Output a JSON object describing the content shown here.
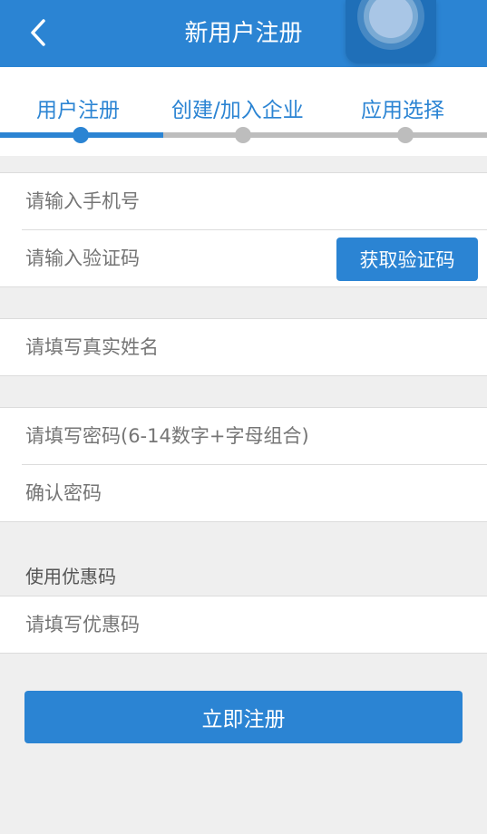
{
  "header": {
    "title": "新用户注册",
    "back_icon": "chevron-left-icon"
  },
  "steps": [
    {
      "label": "用户注册",
      "active": true
    },
    {
      "label": "创建/加入企业",
      "active": false
    },
    {
      "label": "应用选择",
      "active": false
    }
  ],
  "form": {
    "phone_placeholder": "请输入手机号",
    "code_placeholder": "请输入验证码",
    "get_code_label": "获取验证码",
    "name_placeholder": "请填写真实姓名",
    "password_placeholder": "请填写密码(6-14数字+字母组合)",
    "confirm_placeholder": "确认密码",
    "coupon_label": "使用优惠码",
    "coupon_placeholder": "请填写优惠码",
    "submit_label": "立即注册"
  },
  "colors": {
    "accent": "#2b84d3",
    "inactive": "#bdbdbd",
    "background": "#efefef"
  }
}
